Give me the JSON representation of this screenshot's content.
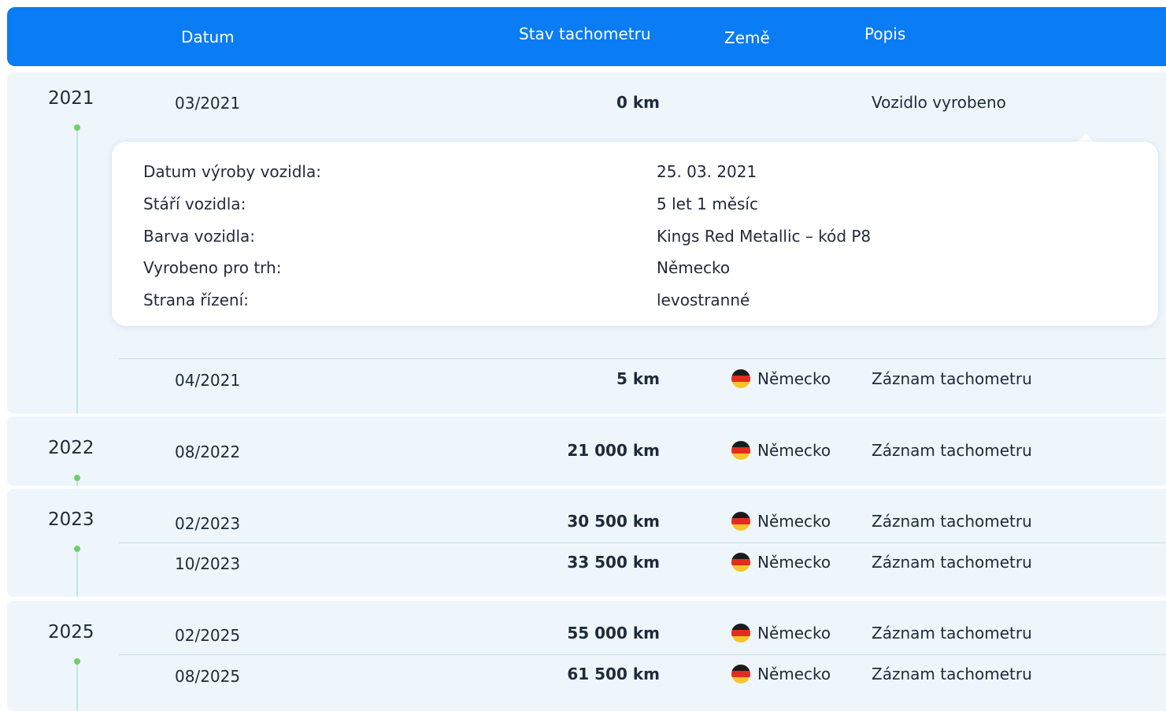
{
  "header": {
    "datum": "Datum",
    "stav": "Stav tachometru",
    "zeme": "Země",
    "popis": "Popis"
  },
  "groups": [
    {
      "year": "2021",
      "rows": [
        {
          "date": "03/2021",
          "km": "0 km",
          "country": "",
          "desc": "Vozidlo vyrobeno"
        },
        {
          "date": "04/2021",
          "km": "5 km",
          "country": "Německo",
          "desc": "Záznam tachometru"
        }
      ]
    },
    {
      "year": "2022",
      "rows": [
        {
          "date": "08/2022",
          "km": "21 000 km",
          "country": "Německo",
          "desc": "Záznam tachometru"
        }
      ]
    },
    {
      "year": "2023",
      "rows": [
        {
          "date": "02/2023",
          "km": "30 500 km",
          "country": "Německo",
          "desc": "Záznam tachometru"
        },
        {
          "date": "10/2023",
          "km": "33 500 km",
          "country": "Německo",
          "desc": "Záznam tachometru"
        }
      ]
    },
    {
      "year": "2025",
      "rows": [
        {
          "date": "02/2025",
          "km": "55 000 km",
          "country": "Německo",
          "desc": "Záznam tachometru"
        },
        {
          "date": "08/2025",
          "km": "61 500 km",
          "country": "Německo",
          "desc": "Záznam tachometru"
        }
      ]
    }
  ],
  "detail": [
    {
      "label": "Datum výroby vozidla:",
      "value": "25. 03. 2021"
    },
    {
      "label": "Stáří vozidla:",
      "value": "5 let 1 měsíc"
    },
    {
      "label": "Barva vozidla:",
      "value": "Kings Red Metallic – kód P8"
    },
    {
      "label": "Vyrobeno pro trh:",
      "value": "Německo"
    },
    {
      "label": "Strana řízení:",
      "value": "levostranné"
    }
  ],
  "icons": {
    "flag": "germany-flag-icon"
  },
  "colors": {
    "header": "#0a7cf4",
    "row_bg": "#eef6fc",
    "timeline_dot": "#6bd26b"
  }
}
